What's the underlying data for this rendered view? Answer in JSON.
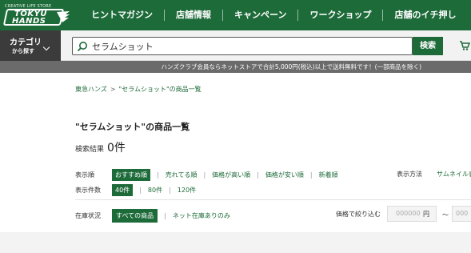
{
  "header": {
    "logo": {
      "tagline": "CREATIVE LIFE STORE",
      "line1": "TOKYU",
      "line2": "HANDS"
    },
    "nav": [
      "ヒントマガジン",
      "店舗情報",
      "キャンペーン",
      "ワークショップ",
      "店舗のイチ押し"
    ]
  },
  "search": {
    "category_label": "カテゴリ",
    "category_sub": "から探す",
    "value": "セラムショット",
    "button": "検索"
  },
  "notice": "ハンズクラブ会員ならネットストアで合計5,000円(税込)以上で送料無料です！(一部商品を除く)",
  "breadcrumb": {
    "home": "東急ハンズ",
    "sep": ">",
    "current": "\"セラムショット\"の商品一覧"
  },
  "title": "\"セラムショット\"の商品一覧",
  "results": {
    "label": "検索結果",
    "count": "0件"
  },
  "sort": {
    "label": "表示順",
    "options": [
      "おすすめ順",
      "売れてる順",
      "価格が高い順",
      "価格が安い順",
      "新着順"
    ],
    "view_label": "表示方法",
    "view_option": "サムネイル表"
  },
  "count": {
    "label": "表示件数",
    "options": [
      "40件",
      "80件",
      "120件"
    ]
  },
  "stock": {
    "label": "在庫状況",
    "options": [
      "すべての商品",
      "ネット在庫ありのみ"
    ]
  },
  "price": {
    "label": "価格で絞り込む",
    "min_placeholder": "000000",
    "unit": "円",
    "tilde": "～",
    "max_placeholder": "000"
  },
  "colors": {
    "brand_green": "#1e6b3a",
    "category_bg": "#3b3b3b",
    "notice_bg": "#6b6b6b"
  }
}
